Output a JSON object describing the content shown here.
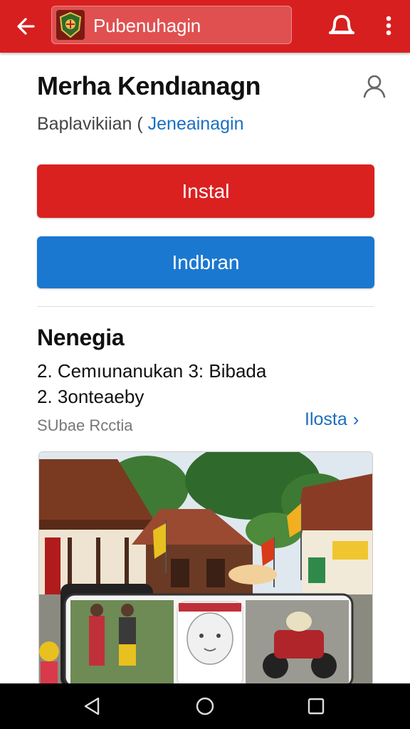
{
  "appbar": {
    "title": "Pubenuhagin",
    "back_icon": "arrow-left-icon",
    "emblem_icon": "coat-of-arms-icon",
    "bell_icon": "notification-bell-icon",
    "more_icon": "more-vertical-icon",
    "color": "#d81f1f"
  },
  "header": {
    "title": "Merha Kendıanagn",
    "subtitle_prefix": "Baplavikiian (",
    "subtitle_link": "Jeneainagin",
    "profile_icon": "user-icon"
  },
  "actions": {
    "install_label": "Instal",
    "open_label": "Indbran",
    "install_color": "#db2020",
    "open_color": "#1b78d0"
  },
  "info": {
    "title": "Nenegia",
    "line1": "2. Cemıunanukan 3: Bibada",
    "line2": "2. 3onteaeby",
    "caption": "SUbae Rcctia",
    "more_label": "Ilosta",
    "more_chevron": "›"
  },
  "screenshot": {
    "image_icon": "village-market-photo"
  },
  "navbar": {
    "back_icon": "nav-back-triangle-icon",
    "home_icon": "nav-home-circle-icon",
    "recents_icon": "nav-recents-square-icon"
  }
}
